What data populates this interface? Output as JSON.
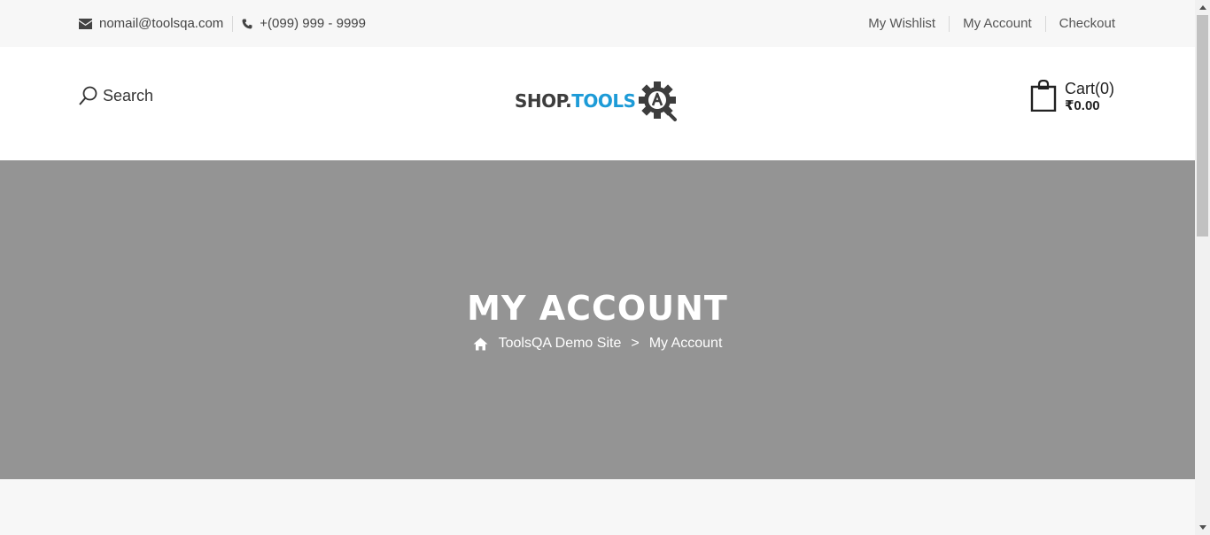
{
  "topbar": {
    "email": "nomail@toolsqa.com",
    "phone": "+(099) 999 - 9999",
    "links": [
      "My Wishlist",
      "My Account",
      "Checkout"
    ]
  },
  "header": {
    "search_label": "Search",
    "logo": {
      "part1": "SHOP.",
      "part2": "TOOLS"
    },
    "cart": {
      "label": "Cart(0)",
      "price": "₹0.00"
    }
  },
  "hero": {
    "title": "MY ACCOUNT",
    "breadcrumb": [
      "ToolsQA Demo Site",
      ">",
      "My Account"
    ]
  },
  "colors": {
    "hero_bg": "#949494",
    "logo_accent": "#1d9bd7",
    "topbar_bg": "#f7f7f7"
  },
  "icons": [
    "envelope-icon",
    "phone-icon",
    "search-icon",
    "logo-gear-icon",
    "shopping-bag-icon",
    "home-icon"
  ]
}
